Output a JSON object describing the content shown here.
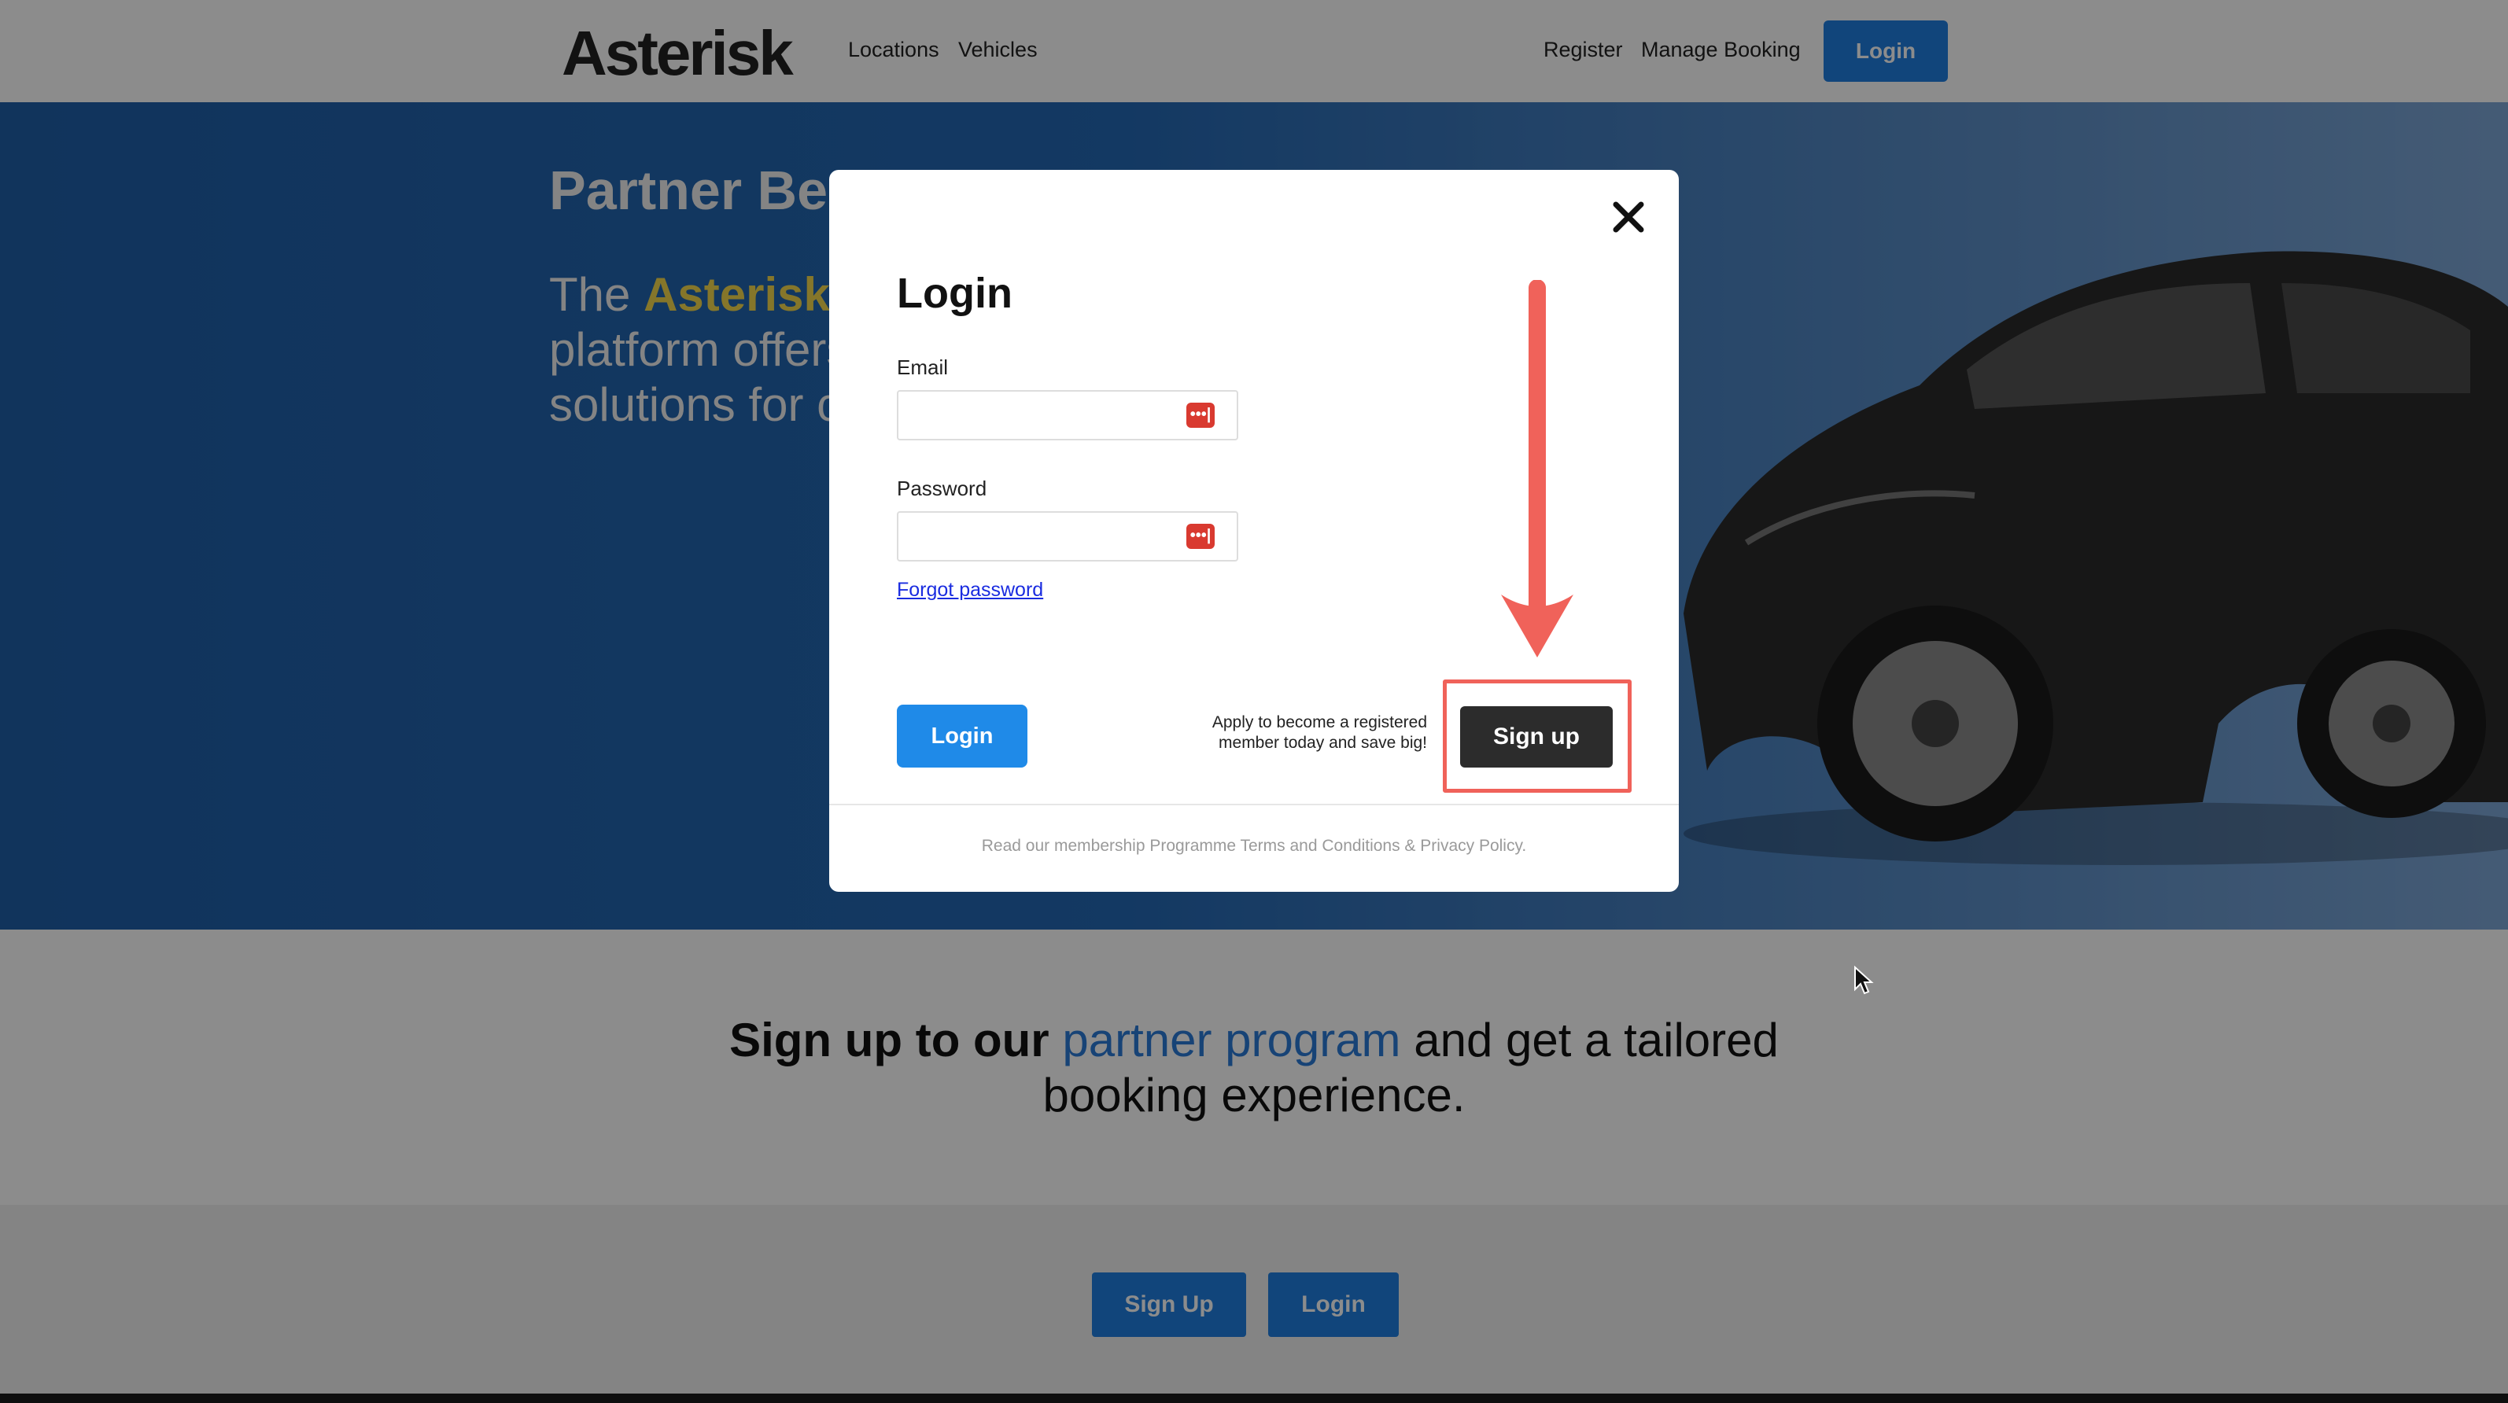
{
  "header": {
    "logo": "Asterisk",
    "nav": [
      "Locations",
      "Vehicles"
    ],
    "right_links": [
      "Register",
      "Manage Booking"
    ],
    "login_label": "Login"
  },
  "hero": {
    "title": "Partner Be",
    "line1_pre": "The ",
    "line1_brand": "Asterisk",
    "line2": "platform offers",
    "line3": "solutions for c"
  },
  "promo": {
    "bold": "Sign up to our ",
    "highlight": "partner program",
    "rest1": " and get a tailored",
    "line2": "booking experience."
  },
  "cta": {
    "signup_label": "Sign Up",
    "login_label": "Login"
  },
  "modal": {
    "title": "Login",
    "email_label": "Email",
    "email_value": "",
    "password_label": "Password",
    "password_value": "",
    "forgot": "Forgot password",
    "login_label": "Login",
    "apply_text": "Apply to become a registered member today and save big!",
    "signup_label": "Sign up",
    "terms": "Read our membership Programme Terms and Conditions & Privacy Policy.",
    "password_manager_icon": "•••|"
  },
  "colors": {
    "primary": "#1f7fe0",
    "brand_highlight": "#f2d84d",
    "annotation": "#f0625a",
    "signup_button": "#2c2c2c"
  },
  "icons": [
    "close-icon",
    "password-manager-icon",
    "red-arrow-icon",
    "mouse-cursor-icon"
  ]
}
